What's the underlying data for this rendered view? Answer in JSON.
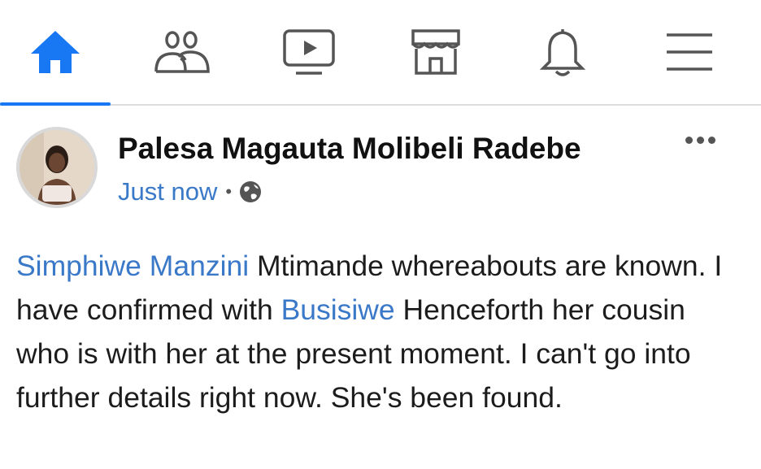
{
  "nav": {
    "items": [
      {
        "icon": "home-icon",
        "active": true
      },
      {
        "icon": "friends-icon",
        "active": false
      },
      {
        "icon": "watch-icon",
        "active": false
      },
      {
        "icon": "marketplace-icon",
        "active": false
      },
      {
        "icon": "notifications-icon",
        "active": false
      },
      {
        "icon": "menu-icon",
        "active": false
      }
    ],
    "accent_color": "#1877f2",
    "icon_color": "#555555"
  },
  "post": {
    "author": "Palesa Magauta Molibeli Radebe",
    "timestamp": "Just now",
    "separator": "•",
    "privacy_icon": "globe-icon",
    "body": {
      "mention_1": "Simphiwe Manzini",
      "text_1": " Mtimande whereabouts are known. I have confirmed with ",
      "mention_2": "Busisiwe",
      "text_2": " Henceforth her cousin who is with her at the present moment. I can't go into further details right now. She's been found."
    },
    "link_color": "#3a78c8"
  }
}
